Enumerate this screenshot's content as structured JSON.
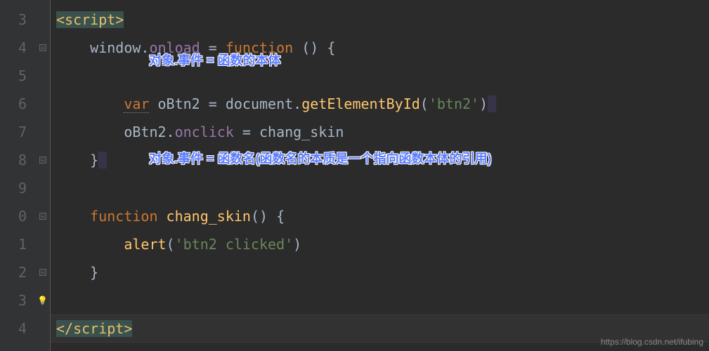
{
  "gutter": [
    "3",
    "4",
    "5",
    "6",
    "7",
    "8",
    "9",
    "0",
    "1",
    "2",
    "3",
    "4"
  ],
  "code": {
    "l3": {
      "tag_open": "<script>"
    },
    "l4": {
      "obj": "window",
      "dot": ".",
      "prop": "onload",
      "eq": " = ",
      "kw": "function",
      "args": " () {"
    },
    "l6": {
      "kw": "var",
      "sp": " ",
      "v": "oBtn2",
      "eq2": " = ",
      "obj2": "document",
      "dot2": ".",
      "fn": "getElementById",
      "paren1": "(",
      "str": "'btn2'",
      "paren2": ")"
    },
    "l7": {
      "obj3": "oBtn2",
      "dot3": ".",
      "prop2": "onclick",
      "eq3": " = ",
      "fn2": "chang_skin"
    },
    "l8": {
      "brace": "}"
    },
    "l10": {
      "kw2": "function",
      "sp2": " ",
      "fn3": "chang_skin",
      "args2": "() {"
    },
    "l11": {
      "fn4": "alert",
      "paren3": "(",
      "str2": "'btn2 clicked'",
      "paren4": ")"
    },
    "l12": {
      "brace2": "}"
    },
    "l14": {
      "tag_close": "</script>"
    }
  },
  "annotations": {
    "a1": "对象.事件 = 函数的本体",
    "a2": "对象.事件 = 函数名(函数名的本质是一个指向函数本体的引用)"
  },
  "watermark": "https://blog.csdn.net/ifubing"
}
